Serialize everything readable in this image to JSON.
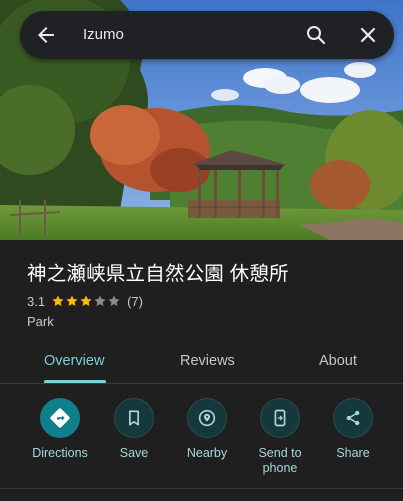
{
  "search": {
    "query": "Izumo",
    "back_icon": "arrow-left-icon",
    "search_icon": "search-icon",
    "close_icon": "close-icon"
  },
  "place": {
    "name": "神之瀬峡県立自然公園 休憩所",
    "rating": "3.1",
    "rating_value": 3.1,
    "rating_max": 5,
    "review_count": "(7)",
    "category": "Park"
  },
  "tabs": [
    {
      "label": "Overview",
      "active": true
    },
    {
      "label": "Reviews",
      "active": false
    },
    {
      "label": "About",
      "active": false
    }
  ],
  "actions": [
    {
      "label": "Directions",
      "icon": "directions-icon"
    },
    {
      "label": "Save",
      "icon": "bookmark-icon"
    },
    {
      "label": "Nearby",
      "icon": "nearby-icon"
    },
    {
      "label": "Send to phone",
      "icon": "send-to-phone-icon"
    },
    {
      "label": "Share",
      "icon": "share-icon"
    }
  ],
  "colors": {
    "accent": "#7ecfd6",
    "primary_action": "#0f7f8c",
    "star": "#fbbc04",
    "background": "#1f1f1f"
  }
}
